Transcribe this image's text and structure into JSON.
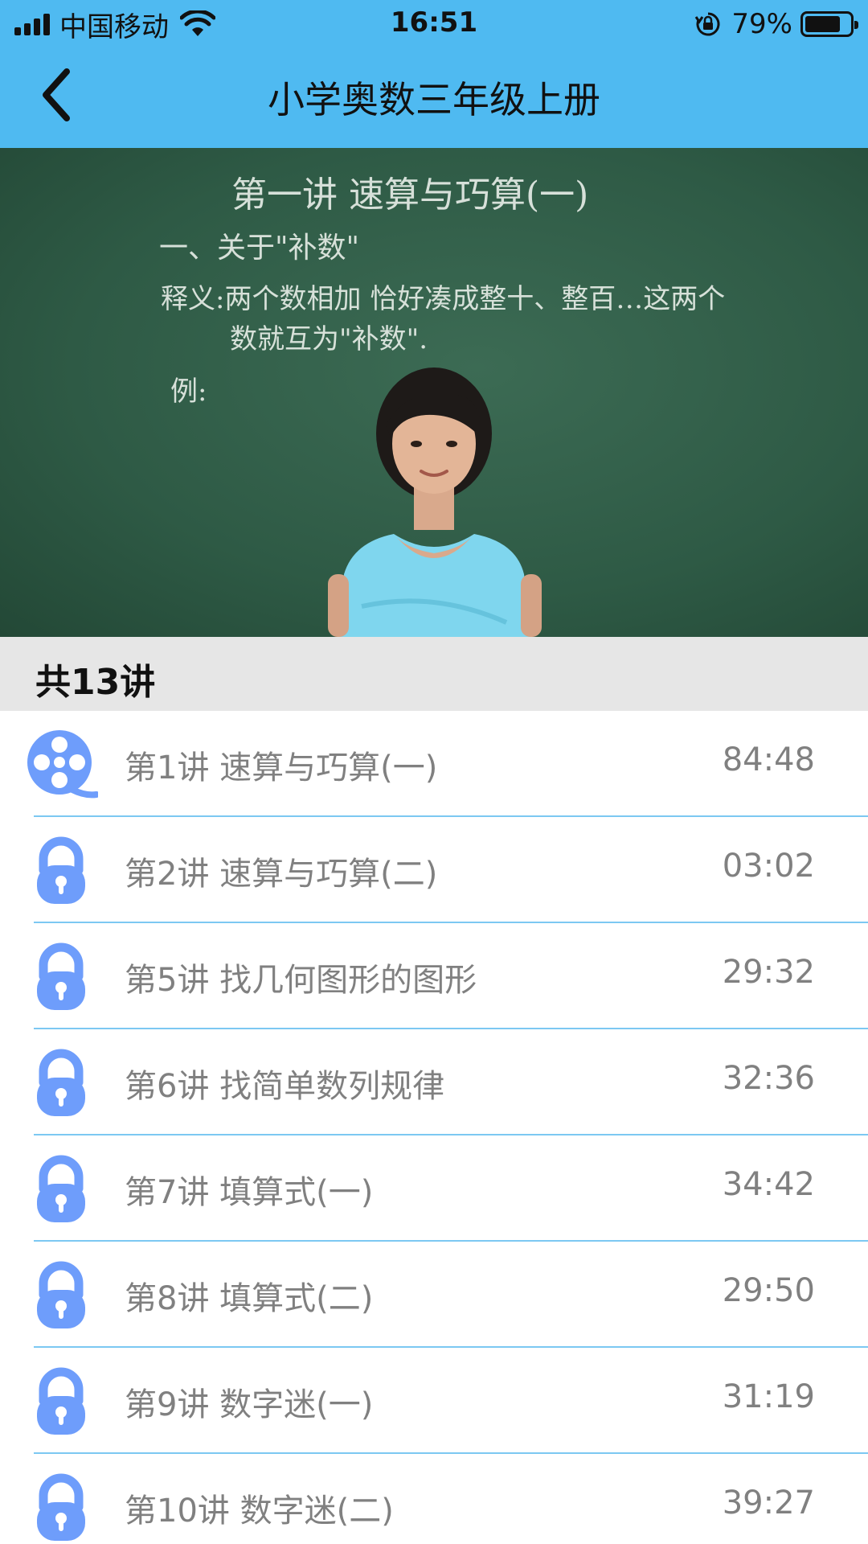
{
  "status_bar": {
    "carrier": "中国移动",
    "time": "16:51",
    "battery_percent": "79%",
    "battery_level": 0.79,
    "icons": [
      "signal-icon",
      "wifi-icon",
      "rotation-lock-icon",
      "battery-icon"
    ]
  },
  "nav": {
    "title": "小学奥数三年级上册",
    "back_icon": "chevron-left-icon"
  },
  "video": {
    "board_lines": [
      "第一讲 速算与巧算(一)",
      "一、关于\"补数\"",
      "释义:两个数相加 恰好凑成整十、整百…这两个",
      "数就互为\"补数\".",
      "例:"
    ]
  },
  "section": {
    "title": "共13讲"
  },
  "lessons": [
    {
      "title": "第1讲 速算与巧算(一)",
      "duration": "84:48",
      "icon": "film-reel-icon"
    },
    {
      "title": "第2讲 速算与巧算(二)",
      "duration": "03:02",
      "icon": "lock-icon"
    },
    {
      "title": "第5讲 找几何图形的图形",
      "duration": "29:32",
      "icon": "lock-icon"
    },
    {
      "title": "第6讲 找简单数列规律",
      "duration": "32:36",
      "icon": "lock-icon"
    },
    {
      "title": "第7讲 填算式(一)",
      "duration": "34:42",
      "icon": "lock-icon"
    },
    {
      "title": "第8讲 填算式(二)",
      "duration": "29:50",
      "icon": "lock-icon"
    },
    {
      "title": "第9讲 数字迷(一)",
      "duration": "31:19",
      "icon": "lock-icon"
    },
    {
      "title": "第10讲 数字迷(二)",
      "duration": "39:27",
      "icon": "lock-icon"
    }
  ],
  "colors": {
    "header_bg": "#4fbaf1",
    "icon_blue": "#6e9dfb",
    "separator": "#7cc8f2",
    "section_bg": "#e6e6e6",
    "text_gray": "#808080"
  }
}
